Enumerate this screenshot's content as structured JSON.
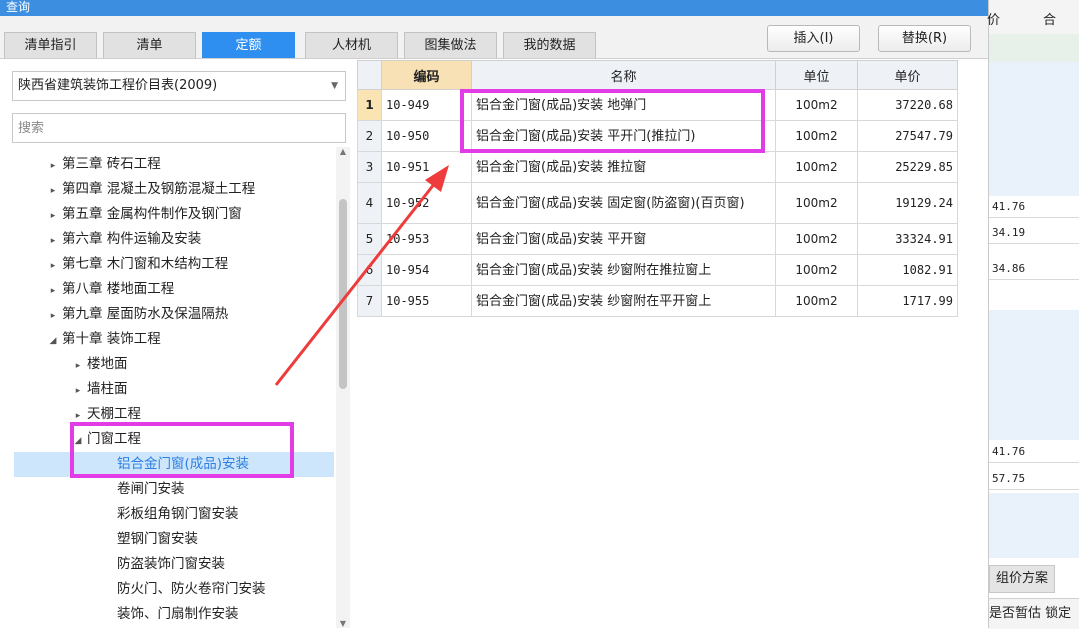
{
  "window": {
    "title": "查询"
  },
  "tabs": [
    {
      "label": "清单指引",
      "active": false
    },
    {
      "label": "清单",
      "active": false
    },
    {
      "label": "定额",
      "active": true
    },
    {
      "label": "人材机",
      "active": false
    },
    {
      "label": "图集做法",
      "active": false
    },
    {
      "label": "我的数据",
      "active": false
    }
  ],
  "buttons": {
    "insert": "插入(I)",
    "replace": "替换(R)"
  },
  "library": {
    "selected": "陕西省建筑装饰工程价目表(2009)"
  },
  "search": {
    "placeholder": "搜索"
  },
  "tree": [
    {
      "label": "第三章 砖石工程",
      "toggle": "▸"
    },
    {
      "label": "第四章 混凝土及钢筋混凝土工程",
      "toggle": "▸"
    },
    {
      "label": "第五章 金属构件制作及钢门窗",
      "toggle": "▸"
    },
    {
      "label": "第六章 构件运输及安装",
      "toggle": "▸"
    },
    {
      "label": "第七章 木门窗和木结构工程",
      "toggle": "▸"
    },
    {
      "label": "第八章 楼地面工程",
      "toggle": "▸"
    },
    {
      "label": "第九章 屋面防水及保温隔热",
      "toggle": "▸"
    },
    {
      "label": "第十章 装饰工程",
      "toggle": "◢"
    },
    {
      "label": "楼地面",
      "toggle": "▸"
    },
    {
      "label": "墙柱面",
      "toggle": "▸"
    },
    {
      "label": "天棚工程",
      "toggle": "▸"
    },
    {
      "label": "门窗工程",
      "toggle": "◢"
    },
    {
      "label": "铝合金门窗(成品)安装",
      "toggle": ""
    },
    {
      "label": "卷闸门安装",
      "toggle": ""
    },
    {
      "label": "彩板组角钢门窗安装",
      "toggle": ""
    },
    {
      "label": "塑钢门窗安装",
      "toggle": ""
    },
    {
      "label": "防盗装饰门窗安装",
      "toggle": ""
    },
    {
      "label": "防火门、防火卷帘门安装",
      "toggle": ""
    },
    {
      "label": "装饰、门扇制作安装",
      "toggle": ""
    }
  ],
  "grid": {
    "headers": {
      "code": "编码",
      "name": "名称",
      "unit": "单位",
      "price": "单价"
    },
    "rows": [
      {
        "no": "1",
        "code": "10-949",
        "name": "铝合金门窗(成品)安装 地弹门",
        "unit": "100m2",
        "price": "37220.68"
      },
      {
        "no": "2",
        "code": "10-950",
        "name": "铝合金门窗(成品)安装 平开门(推拉门)",
        "unit": "100m2",
        "price": "27547.79"
      },
      {
        "no": "3",
        "code": "10-951",
        "name": "铝合金门窗(成品)安装 推拉窗",
        "unit": "100m2",
        "price": "25229.85"
      },
      {
        "no": "4",
        "code": "10-952",
        "name": "铝合金门窗(成品)安装 固定窗(防盗窗)(百页窗)",
        "unit": "100m2",
        "price": "19129.24"
      },
      {
        "no": "5",
        "code": "10-953",
        "name": "铝合金门窗(成品)安装 平开窗",
        "unit": "100m2",
        "price": "33324.91"
      },
      {
        "no": "6",
        "code": "10-954",
        "name": "铝合金门窗(成品)安装 纱窗附在推拉窗上",
        "unit": "100m2",
        "price": "1082.91"
      },
      {
        "no": "7",
        "code": "10-955",
        "name": "铝合金门窗(成品)安装 纱窗附在平开窗上",
        "unit": "100m2",
        "price": "1717.99"
      }
    ]
  },
  "background_panel": {
    "header_a": "价",
    "header_b": "合",
    "cells": [
      "41.76",
      "34.19",
      "34.86",
      "41.76",
      "57.75"
    ],
    "scheme_button": "组价方案",
    "footer": "是否暂估 锁定"
  },
  "colors": {
    "accent": "#2e8ff0",
    "highlight": "#e23ce6",
    "arrow": "#ee3b3b"
  }
}
